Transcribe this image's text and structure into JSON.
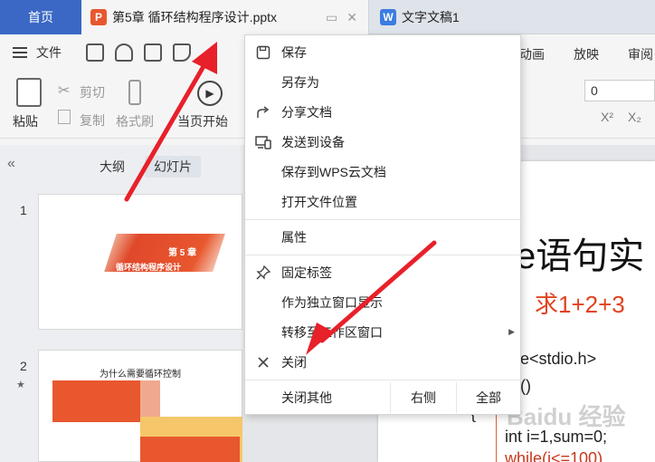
{
  "tabs": {
    "home": "首页",
    "pptx": "第5章 循环结构程序设计.pptx",
    "doc": "文字文稿1",
    "pptx_icon": "P",
    "doc_icon": "W"
  },
  "menu": {
    "file": "文件",
    "right_tabs": [
      "动画",
      "放映",
      "审阅"
    ]
  },
  "ribbon": {
    "paste": "粘贴",
    "cut": "剪切",
    "copy": "复制",
    "format_painter": "格式刷",
    "from_current": "当页开始",
    "font_size": "0",
    "superscript": "X²",
    "subscript": "X₂"
  },
  "left_pane": {
    "collapse_glyph": "«",
    "outline_tab": "大纲",
    "slides_tab": "幻灯片",
    "slide1_num": "1",
    "slide2_num": "2",
    "slide2_star": "★",
    "slide1_chapter": "第 5 章",
    "slide1_subtitle": "循环结构程序设计",
    "slide2_title": "为什么需要循环控制"
  },
  "slide": {
    "big_text": "e语句实",
    "red_text": "】求1+2+3",
    "code_lines": [
      "de<stdio.h>",
      "n()",
      "{",
      "int i=1,sum=0;",
      "while(i<=100)"
    ]
  },
  "watermark": "Baidu 经验",
  "context_menu": {
    "items": [
      {
        "label": "保存",
        "icon": "save-icon"
      },
      {
        "label": "另存为",
        "icon": ""
      },
      {
        "label": "分享文档",
        "icon": "share-icon"
      },
      {
        "label": "发送到设备",
        "icon": "device-icon"
      },
      {
        "label": "保存到WPS云文档",
        "icon": ""
      },
      {
        "label": "打开文件位置",
        "icon": ""
      },
      {
        "label": "属性",
        "icon": ""
      },
      {
        "label": "固定标签",
        "icon": "pin-icon"
      },
      {
        "label": "作为独立窗口显示",
        "icon": ""
      },
      {
        "label": "转移至工作区窗口",
        "icon": ""
      },
      {
        "label": "关闭",
        "icon": "close-icon"
      }
    ],
    "close_others": "关闭其他",
    "right_side": "右侧",
    "all": "全部"
  },
  "colors": {
    "home_tab": "#3a68c4",
    "accent_red": "#e2421e",
    "arrow_red": "#e8202a"
  }
}
